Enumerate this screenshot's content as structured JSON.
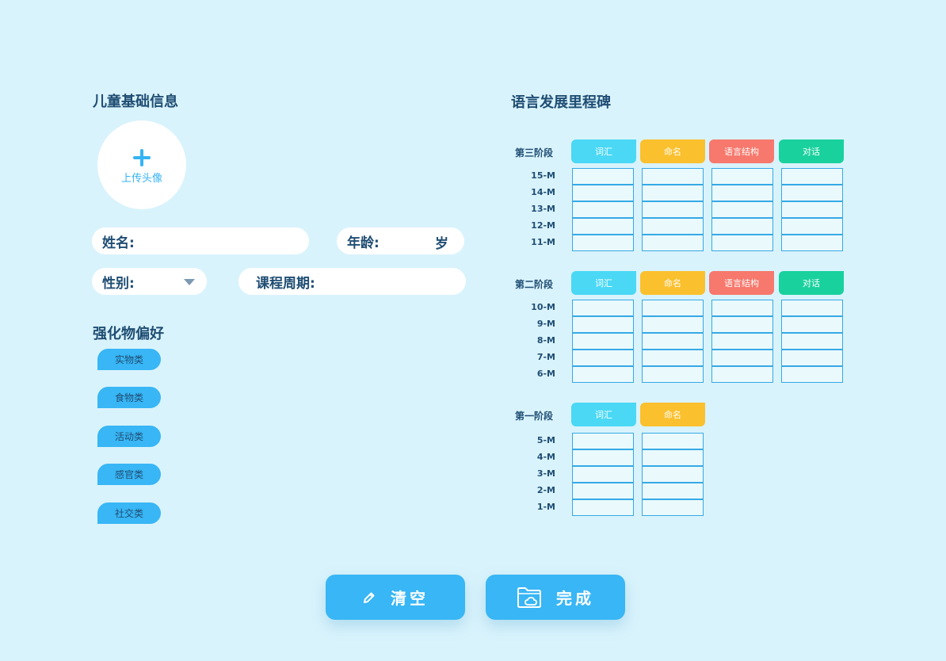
{
  "left": {
    "basic_title": "儿童基础信息",
    "avatar": {
      "upload_label": "上传头像"
    },
    "fields": {
      "name_label": "姓名:",
      "age_label": "年龄:",
      "age_suffix": "岁",
      "gender_label": "性别:",
      "course_label": "课程周期:"
    },
    "reinforcer_title": "强化物偏好",
    "reinforcers": [
      "实物类",
      "食物类",
      "活动类",
      "感官类",
      "社交类"
    ]
  },
  "right": {
    "title": "语言发展里程碑",
    "stages": [
      {
        "label": "第三阶段",
        "columns": [
          {
            "label": "词汇",
            "color": "#4ad8f5"
          },
          {
            "label": "命名",
            "color": "#fbc02d"
          },
          {
            "label": "语言结构",
            "color": "#f7786c"
          },
          {
            "label": "对话",
            "color": "#19d19d"
          }
        ],
        "rows": [
          "15-M",
          "14-M",
          "13-M",
          "12-M",
          "11-M"
        ]
      },
      {
        "label": "第二阶段",
        "columns": [
          {
            "label": "词汇",
            "color": "#4ad8f5"
          },
          {
            "label": "命名",
            "color": "#fbc02d"
          },
          {
            "label": "语言结构",
            "color": "#f7786c"
          },
          {
            "label": "对话",
            "color": "#19d19d"
          }
        ],
        "rows": [
          "10-M",
          "9-M",
          "8-M",
          "7-M",
          "6-M"
        ]
      },
      {
        "label": "第一阶段",
        "columns": [
          {
            "label": "词汇",
            "color": "#4ad8f5"
          },
          {
            "label": "命名",
            "color": "#fbc02d"
          }
        ],
        "rows": [
          "5-M",
          "4-M",
          "3-M",
          "2-M",
          "1-M"
        ]
      }
    ]
  },
  "actions": {
    "clear_label": "清空",
    "done_label": "完成"
  }
}
